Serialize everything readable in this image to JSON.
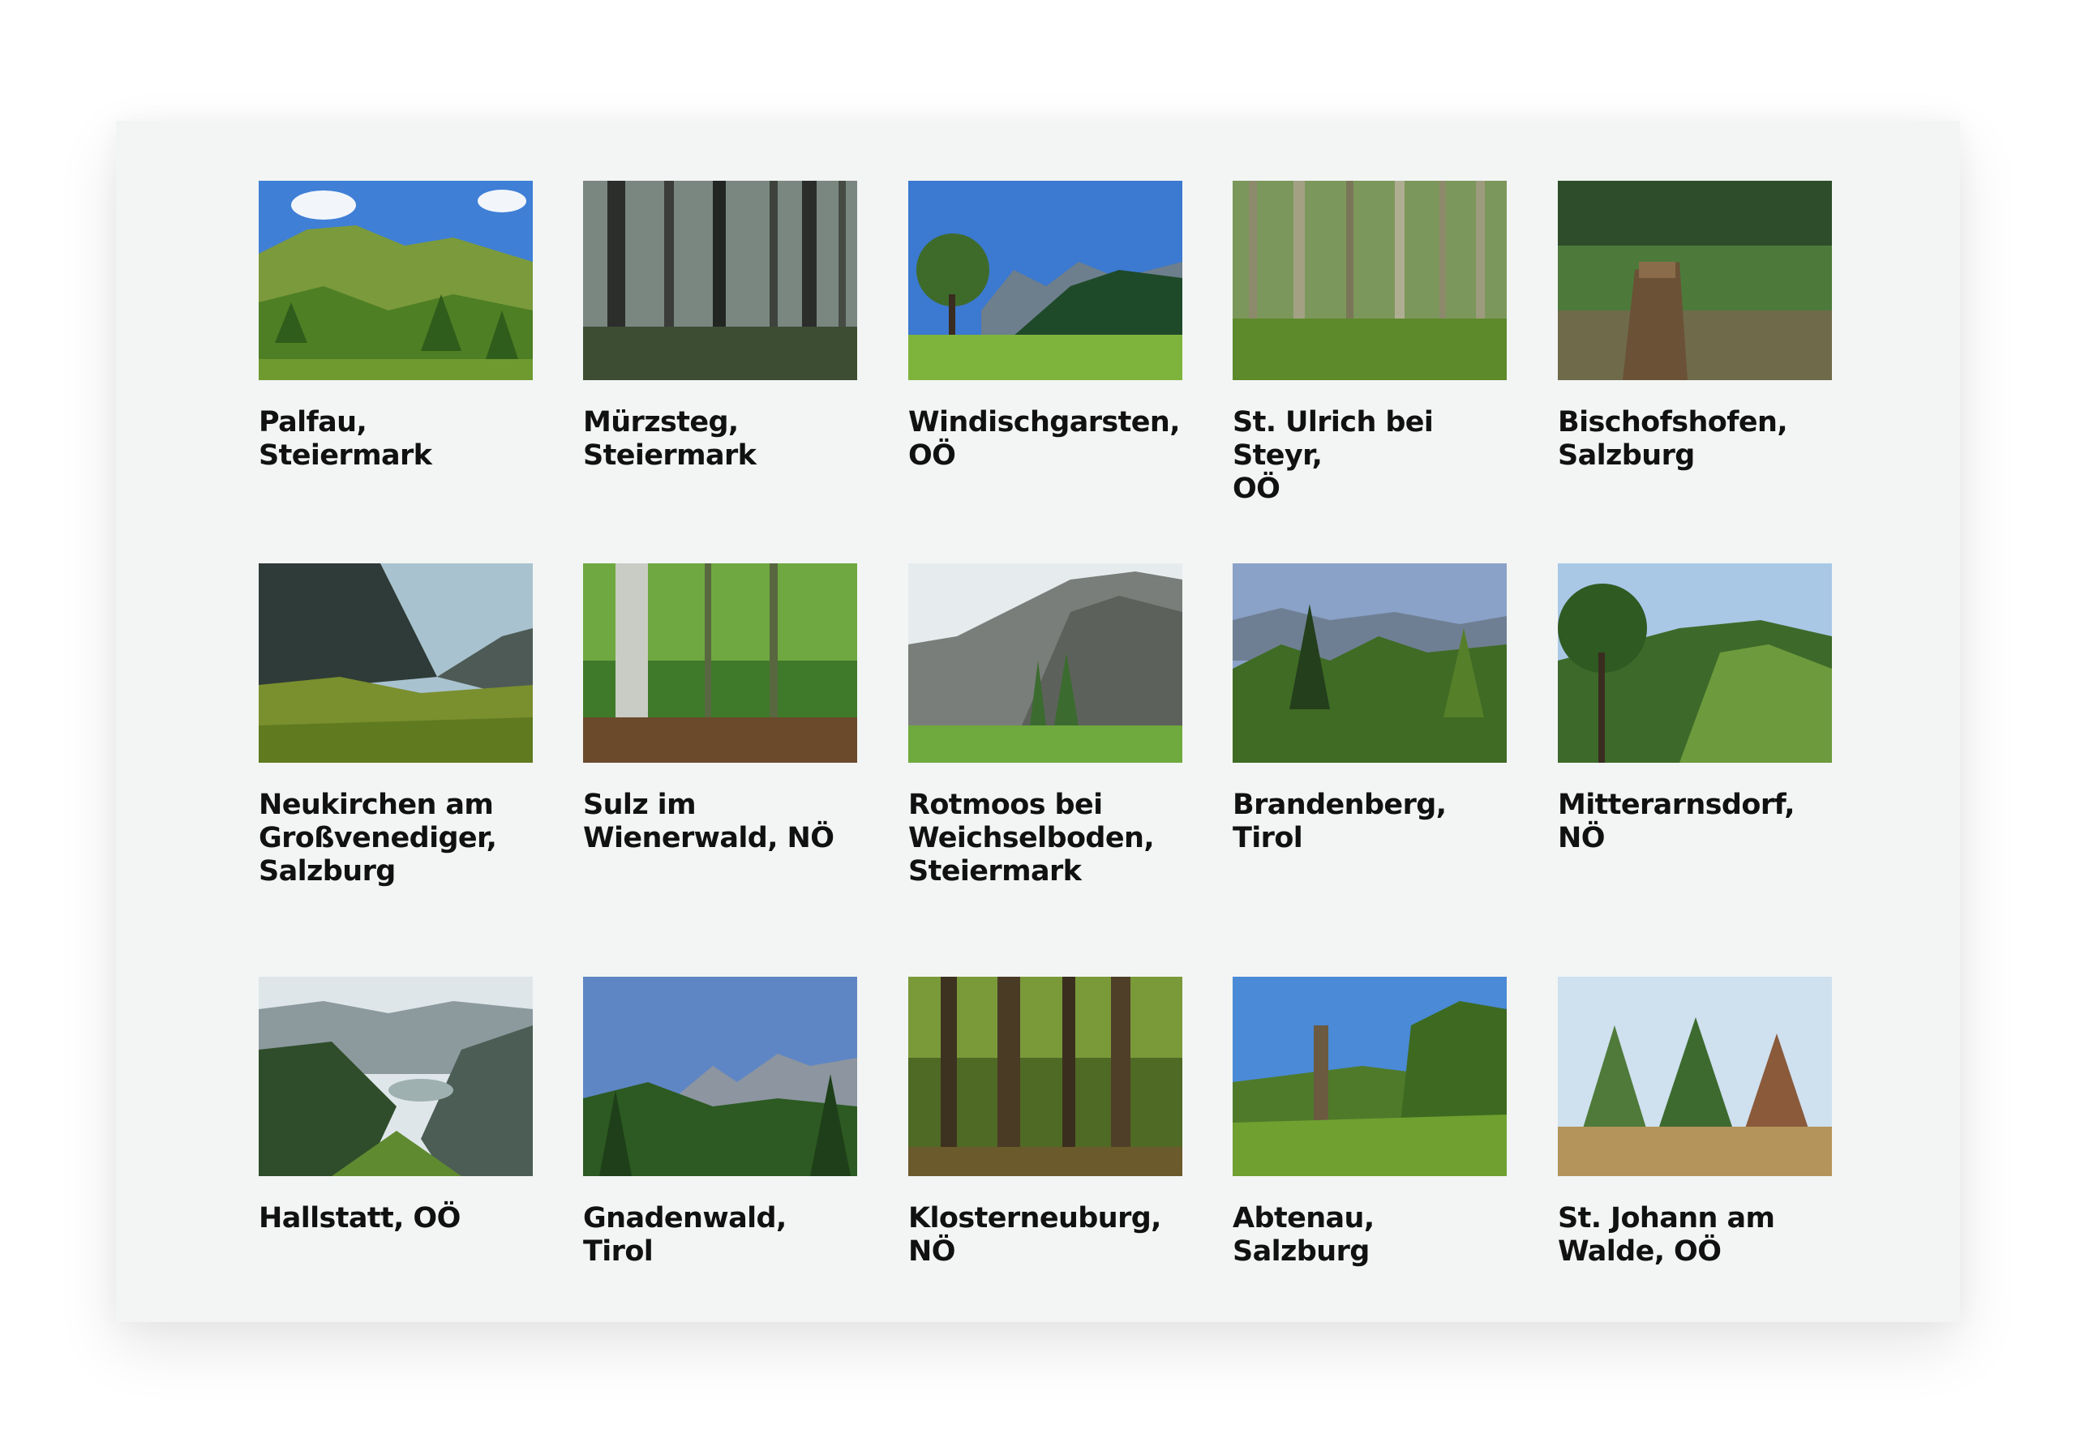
{
  "gallery": {
    "items": [
      {
        "caption": "Palfau, Steiermark",
        "photo": "mountain-meadow-photo"
      },
      {
        "caption": "Mürzsteg,\nSteiermark",
        "photo": "spruce-forest-photo"
      },
      {
        "caption": "Windischgarsten,\nOÖ",
        "photo": "alpine-pasture-photo"
      },
      {
        "caption": "St. Ulrich bei Steyr,\nOÖ",
        "photo": "mixed-forest-photo"
      },
      {
        "caption": "Bischofshofen,\nSalzburg",
        "photo": "tree-stump-photo"
      },
      {
        "caption": "Neukirchen am\nGroßvenediger,\nSalzburg",
        "photo": "mountain-shrubs-photo"
      },
      {
        "caption": "Sulz im\nWienerwald, NÖ",
        "photo": "beech-forest-photo"
      },
      {
        "caption": "Rotmoos bei\nWeichselboden,\nSteiermark",
        "photo": "limestone-valley-photo"
      },
      {
        "caption": "Brandenberg, Tirol",
        "photo": "conifer-ridge-photo"
      },
      {
        "caption": "Mitterarnsdorf, NÖ",
        "photo": "hillside-clearing-photo"
      },
      {
        "caption": "Hallstatt, OÖ",
        "photo": "lake-valley-photo"
      },
      {
        "caption": "Gnadenwald, Tirol",
        "photo": "karwendel-peaks-photo"
      },
      {
        "caption": "Klosterneuburg,\nNÖ",
        "photo": "oak-forest-photo"
      },
      {
        "caption": "Abtenau, Salzburg",
        "photo": "dead-tree-photo"
      },
      {
        "caption": "St. Johann am\nWalde, OÖ",
        "photo": "young-trees-photo"
      }
    ]
  }
}
